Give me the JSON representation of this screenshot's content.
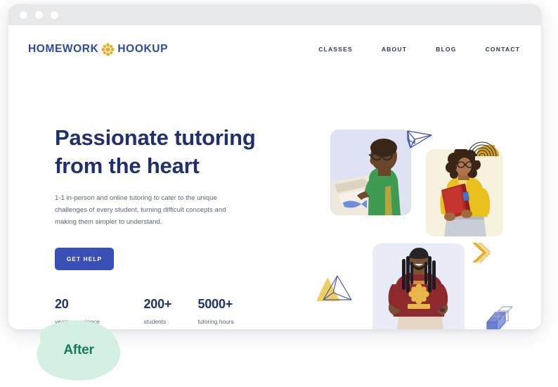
{
  "browser": {
    "dots": [
      "window-dot-1",
      "window-dot-2",
      "window-dot-3"
    ]
  },
  "header": {
    "logo": {
      "text_left": "HOMEWORK",
      "text_right": "HOOKUP",
      "mark_icon": "flower-star-icon",
      "color": "#2f49a8",
      "mark_color": "#e8ae24"
    },
    "nav": [
      {
        "label": "CLASSES"
      },
      {
        "label": "ABOUT"
      },
      {
        "label": "BLOG"
      },
      {
        "label": "CONTACT"
      }
    ]
  },
  "hero": {
    "title_line1": "Passionate tutoring",
    "title_line2": "from the heart",
    "subtitle": "1-1 in-person and online tutoring to cater to the unique challenges of every student, turning difficult concepts and making them simpler to understand.",
    "cta_label": "GET HELP",
    "cta_color": "#3a4fb5",
    "title_color": "#20306e",
    "stats": [
      {
        "value": "20",
        "label": "years experience"
      },
      {
        "value": "200+",
        "label": "students"
      },
      {
        "value": "5000+",
        "label": "tutoring hours"
      }
    ]
  },
  "collage": {
    "photos": [
      {
        "name": "photo-boy-writing",
        "alt": "Boy with glasses in green shirt writing at a desk",
        "card_color": "#dfe2f2"
      },
      {
        "name": "photo-student-books",
        "alt": "Student in yellow jacket holding red books",
        "card_color": "#f7f2dd"
      },
      {
        "name": "photo-tutor-tshirt",
        "alt": "Smiling tutor in maroon Homework Hookup t-shirt",
        "card_color": "#e9ebf7"
      }
    ],
    "decorations": [
      {
        "name": "prism-triangle-icon",
        "color": "#3a4fb5"
      },
      {
        "name": "concentric-arcs-icon",
        "color": "#2b2b2b",
        "accent": "#d8a01f"
      },
      {
        "name": "double-chevron-icon",
        "color": "#e8ae24"
      },
      {
        "name": "triangle-pair-icon",
        "color": "#efcf63",
        "accent": "#3a4fb5"
      },
      {
        "name": "isometric-cube-icon",
        "color": "#5a6fc4"
      }
    ]
  },
  "badge": {
    "label": "After",
    "fill_color": "#d4f0e2",
    "text_color": "#1a7a5e"
  }
}
